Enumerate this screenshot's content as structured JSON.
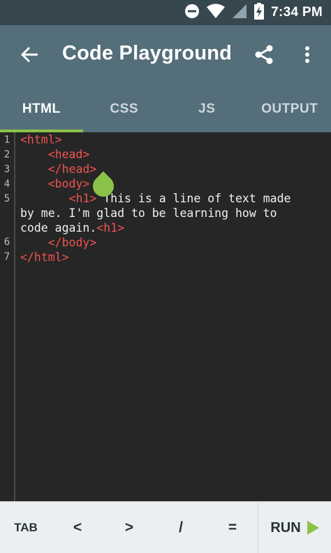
{
  "status_bar": {
    "time": "7:34 PM"
  },
  "app_bar": {
    "title": "Code Playground"
  },
  "tabs": [
    {
      "label": "HTML",
      "active": true
    },
    {
      "label": "CSS",
      "active": false
    },
    {
      "label": "JS",
      "active": false
    },
    {
      "label": "OUTPUT",
      "active": false
    }
  ],
  "editor": {
    "line_numbers": [
      "1",
      "2",
      "3",
      "4",
      "5",
      "6",
      "7"
    ],
    "code": {
      "l1_tag": "<html>",
      "l2_tag": "<head>",
      "l3_tag": "</head>",
      "l4_tag": "<body>",
      "l5_open_tag": "<h1>",
      "l5_text_a": " This is a line of text made",
      "l5_text_b": "by me. I'm glad to be learning how to",
      "l5_text_c": "code again.",
      "l5_close_tag": "<h1>",
      "l6_tag": "</body>",
      "l7_tag": "</html>"
    }
  },
  "bottom_bar": {
    "tab_label": "TAB",
    "symbols": [
      "<",
      ">",
      "/",
      "="
    ],
    "run_label": "RUN"
  },
  "colors": {
    "accent": "#8bc34a",
    "tag": "#ef5350",
    "appbar": "#546e7a",
    "statusbar": "#37474f"
  }
}
